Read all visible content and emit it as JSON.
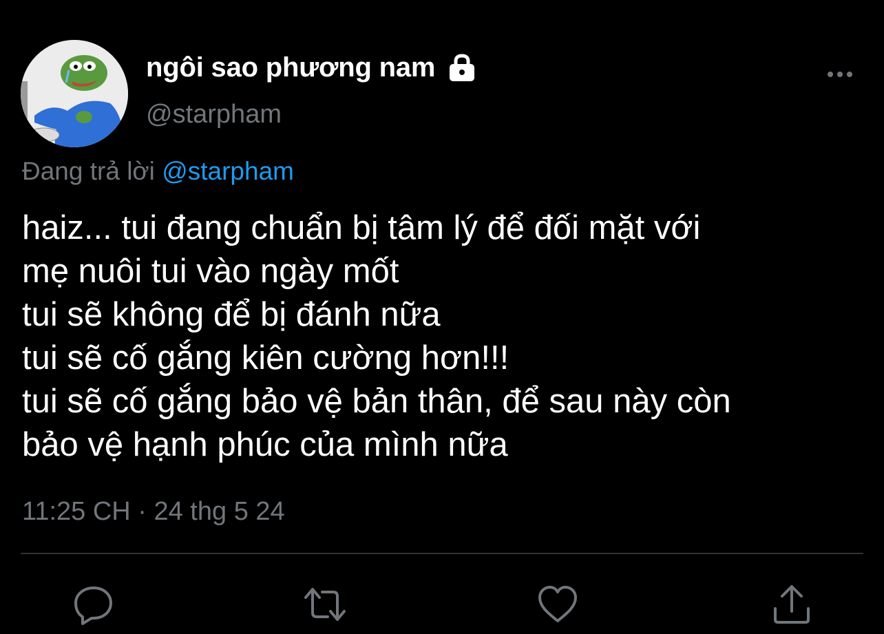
{
  "tweet": {
    "author": {
      "display_name": "ngôi sao phương nam",
      "handle": "@starpham",
      "protected_icon": "lock-icon",
      "avatar_icon": "pepe-frog-avatar"
    },
    "reply_to": {
      "prefix": "Đang trả lời",
      "mention": "@starpham"
    },
    "text_lines": [
      "haiz... tui đang chuẩn bị tâm lý để đối mặt với",
      "mẹ nuôi tui vào ngày mốt",
      "tui sẽ không để bị đánh nữa",
      "tui sẽ cố gắng kiên cường hơn!!!",
      "tui sẽ cố gắng bảo vệ bản thân, để sau này còn",
      "bảo vệ hạnh phúc của mình nữa"
    ],
    "timestamp": "11:25 CH · 24 thg 5 24"
  },
  "actions": {
    "icons": [
      "reply-icon",
      "retweet-icon",
      "like-icon",
      "share-icon"
    ],
    "more_icon": "more-options-icon"
  },
  "colors": {
    "background": "#000000",
    "primary_text": "#ffffff",
    "secondary_text": "#71767b",
    "accent": "#1d9bf0",
    "divider": "#2f3336"
  }
}
